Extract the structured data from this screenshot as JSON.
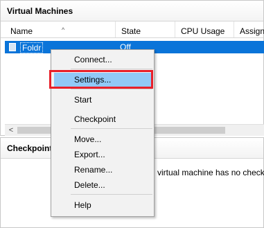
{
  "vm_pane": {
    "title": "Virtual Machines",
    "columns": [
      "Name",
      "State",
      "CPU Usage",
      "Assign"
    ],
    "rows": [
      {
        "name": "Foldr",
        "state": "Off"
      }
    ]
  },
  "checkpoints_pane": {
    "title": "Checkpoints",
    "message": "virtual machine has no checkpoi"
  },
  "context_menu": {
    "items": [
      "Connect...",
      "Settings...",
      "Start",
      "Checkpoint",
      "Move...",
      "Export...",
      "Rename...",
      "Delete...",
      "Help"
    ],
    "highlighted": "Settings..."
  },
  "colors": {
    "selection": "#0a74d9",
    "menu_highlight": "#91c9f7",
    "annotation_box": "#e8202a"
  }
}
